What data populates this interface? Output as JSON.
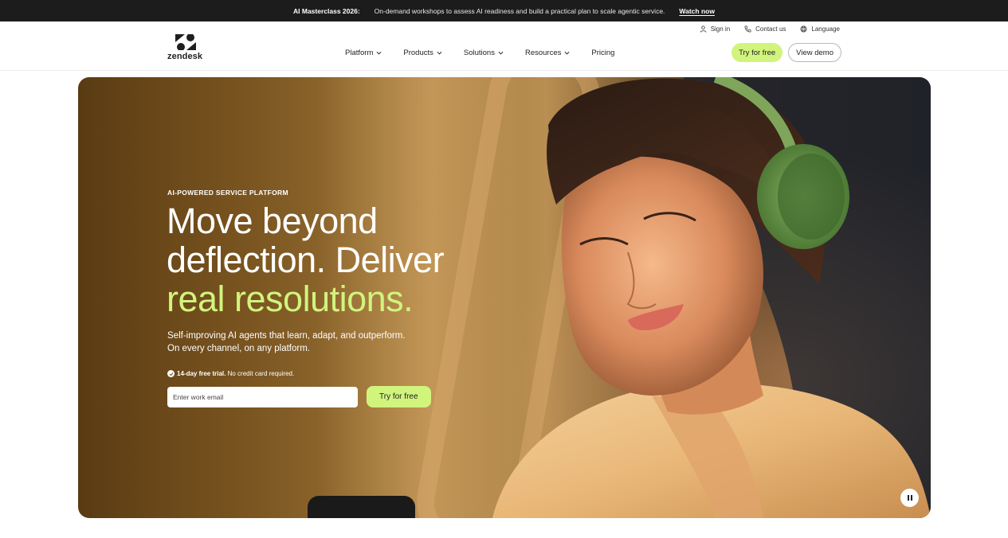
{
  "announcement": {
    "title": "AI Masterclass 2026:",
    "text": "On-demand workshops to assess AI readiness and build a practical plan to scale agentic service.",
    "link": "Watch now"
  },
  "header": {
    "logo_text": "zendesk",
    "utility": {
      "sign_in": "Sign in",
      "contact": "Contact us",
      "language": "Language"
    },
    "nav": [
      {
        "label": "Platform"
      },
      {
        "label": "Products"
      },
      {
        "label": "Solutions"
      },
      {
        "label": "Resources"
      },
      {
        "label": "Pricing"
      }
    ],
    "try_free": "Try for free",
    "view_demo": "View demo"
  },
  "hero": {
    "eyebrow": "AI-POWERED SERVICE PLATFORM",
    "headline_line1": "Move beyond",
    "headline_line2": "deflection. Deliver",
    "headline_line3": "real resolutions.",
    "sub_line1": "Self-improving AI agents that learn, adapt, and outperform.",
    "sub_line2": "On every channel, on any platform.",
    "trial_bold": "14-day free trial.",
    "trial_rest": " No credit card required.",
    "email_placeholder": "Enter work email",
    "cta": "Try for free"
  },
  "colors": {
    "accent": "#d1f47d",
    "announcement_bg": "#1c1c1c"
  }
}
